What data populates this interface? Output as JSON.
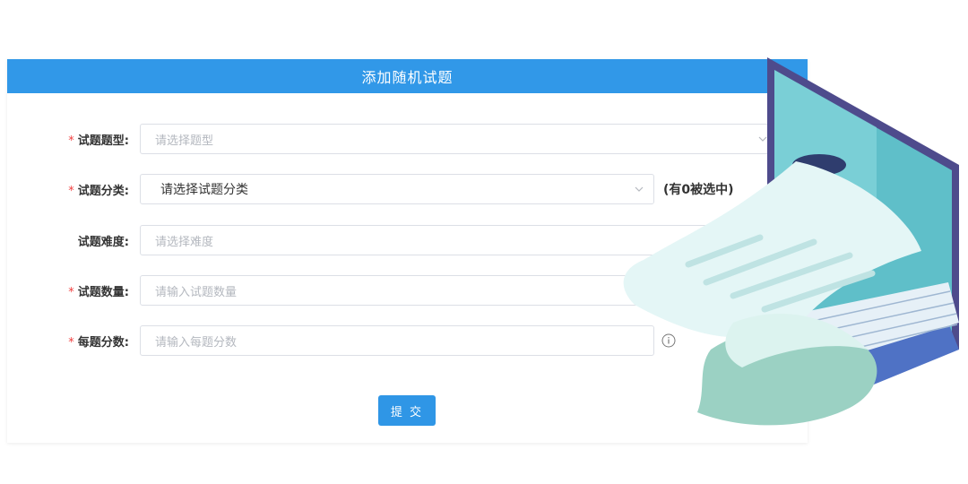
{
  "dialog": {
    "title": "添加随机试题",
    "required_mark": "*",
    "fields": [
      {
        "label": "试题题型:",
        "required": true,
        "placeholder": "请选择题型",
        "value": ""
      },
      {
        "label": "试题分类:",
        "required": true,
        "placeholder": "",
        "value": "请选择试题分类",
        "extra": "(有0被选中)"
      },
      {
        "label": "试题难度:",
        "required": false,
        "placeholder": "请选择难度",
        "value": ""
      },
      {
        "label": "试题数量:",
        "required": true,
        "placeholder": "请输入试题数量",
        "value": ""
      },
      {
        "label": "每题分数:",
        "required": true,
        "placeholder": "请输入每题分数",
        "value": ""
      }
    ],
    "submit_label": "提 交"
  },
  "colors": {
    "header_bg": "#3198e8",
    "button_bg": "#2f96e6",
    "required_star": "#f04040",
    "border": "#dcdfe6"
  },
  "icons": {
    "select_arrow": "chevron-down-icon",
    "info": "info-circle-icon",
    "illustration": "laptop-document-illustration"
  }
}
